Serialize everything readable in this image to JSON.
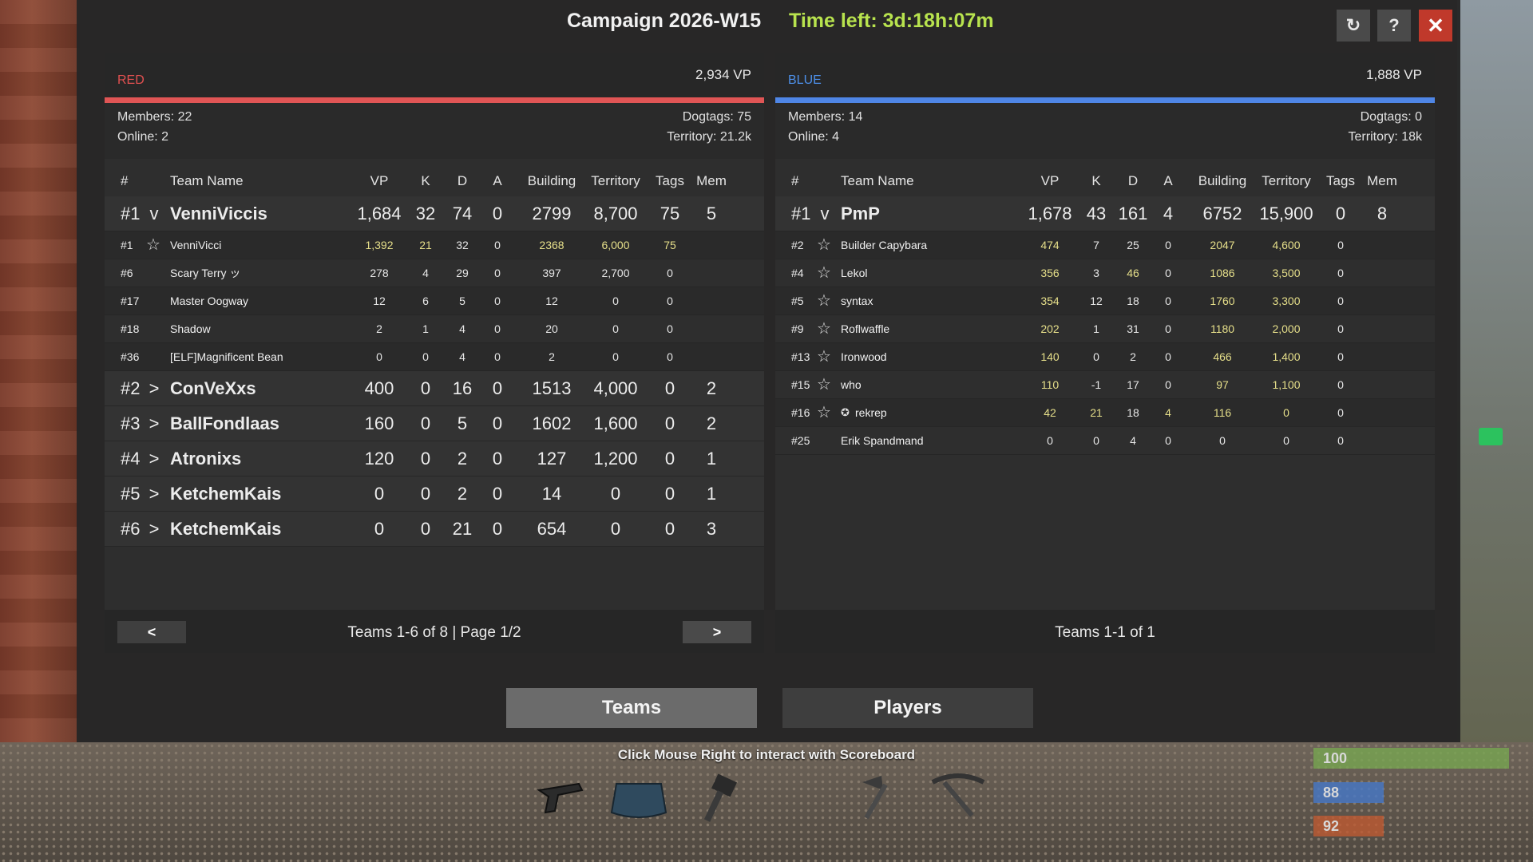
{
  "header": {
    "title": "Campaign 2026-W15",
    "time_left": "Time left: 3d:18h:07m",
    "refresh_icon": "↻",
    "help_icon": "?",
    "close_icon": "✕"
  },
  "columns": [
    "#",
    "Team Name",
    "VP",
    "K",
    "D",
    "A",
    "Building",
    "Territory",
    "Tags",
    "Mem"
  ],
  "red": {
    "name": "RED",
    "vp": "2,934 VP",
    "members": "Members: 22",
    "online": "Online: 2",
    "dogtags": "Dogtags: 75",
    "territory": "Territory: 21.2k",
    "rows": [
      {
        "type": "parent",
        "rank": "#1",
        "toggle": "v",
        "name": "VenniViccis",
        "vp": "1,684",
        "k": "32",
        "d": "74",
        "a": "0",
        "building": "2799",
        "territory": "8,700",
        "tags": "75",
        "mem": "5"
      },
      {
        "type": "child",
        "rank": "#1",
        "star": true,
        "name": "VenniVicci",
        "vp": "1,392",
        "k": "21",
        "d": "32",
        "a": "0",
        "building": "2368",
        "territory": "6,000",
        "tags": "75",
        "mem": ""
      },
      {
        "type": "child",
        "rank": "#6",
        "star": false,
        "name": "Scary Terry ッ",
        "vp": "278",
        "k": "4",
        "d": "29",
        "a": "0",
        "building": "397",
        "territory": "2,700",
        "tags": "0",
        "mem": ""
      },
      {
        "type": "child",
        "rank": "#17",
        "star": false,
        "name": "Master Oogway",
        "vp": "12",
        "k": "6",
        "d": "5",
        "a": "0",
        "building": "12",
        "territory": "0",
        "tags": "0",
        "mem": ""
      },
      {
        "type": "child",
        "rank": "#18",
        "star": false,
        "name": "Shadow",
        "vp": "2",
        "k": "1",
        "d": "4",
        "a": "0",
        "building": "20",
        "territory": "0",
        "tags": "0",
        "mem": ""
      },
      {
        "type": "child",
        "rank": "#36",
        "star": false,
        "name": "[ELF]Magnificent Bean",
        "vp": "0",
        "k": "0",
        "d": "4",
        "a": "0",
        "building": "2",
        "territory": "0",
        "tags": "0",
        "mem": ""
      },
      {
        "type": "parent",
        "rank": "#2",
        "toggle": ">",
        "name": "ConVeXxs",
        "vp": "400",
        "k": "0",
        "d": "16",
        "a": "0",
        "building": "1513",
        "territory": "4,000",
        "tags": "0",
        "mem": "2"
      },
      {
        "type": "parent",
        "rank": "#3",
        "toggle": ">",
        "name": "BallFondlaas",
        "vp": "160",
        "k": "0",
        "d": "5",
        "a": "0",
        "building": "1602",
        "territory": "1,600",
        "tags": "0",
        "mem": "2"
      },
      {
        "type": "parent",
        "rank": "#4",
        "toggle": ">",
        "name": "Atronixs",
        "vp": "120",
        "k": "0",
        "d": "2",
        "a": "0",
        "building": "127",
        "territory": "1,200",
        "tags": "0",
        "mem": "1"
      },
      {
        "type": "parent",
        "rank": "#5",
        "toggle": ">",
        "name": "KetchemKais",
        "vp": "0",
        "k": "0",
        "d": "2",
        "a": "0",
        "building": "14",
        "territory": "0",
        "tags": "0",
        "mem": "1"
      },
      {
        "type": "parent",
        "rank": "#6",
        "toggle": ">",
        "name": "KetchemKais",
        "vp": "0",
        "k": "0",
        "d": "21",
        "a": "0",
        "building": "654",
        "territory": "0",
        "tags": "0",
        "mem": "3"
      }
    ],
    "footer": "Teams 1-6 of 8  |  Page 1/2",
    "prev": "<",
    "next": ">"
  },
  "blue": {
    "name": "BLUE",
    "vp": "1,888 VP",
    "members": "Members: 14",
    "online": "Online: 4",
    "dogtags": "Dogtags: 0",
    "territory": "Territory: 18k",
    "rows": [
      {
        "type": "parent",
        "rank": "#1",
        "toggle": "v",
        "name": "PmP",
        "vp": "1,678",
        "k": "43",
        "d": "161",
        "a": "4",
        "building": "6752",
        "territory": "15,900",
        "tags": "0",
        "mem": "8"
      },
      {
        "type": "child",
        "rank": "#2",
        "star": true,
        "name": "Builder Capybara",
        "vp": "474",
        "k": "7",
        "d": "25",
        "a": "0",
        "building": "2047",
        "territory": "4,600",
        "tags": "0",
        "mem": ""
      },
      {
        "type": "child",
        "rank": "#4",
        "star": true,
        "name": "Lekol",
        "vp": "356",
        "k": "3",
        "d": "46",
        "a": "0",
        "building": "1086",
        "territory": "3,500",
        "tags": "0",
        "mem": ""
      },
      {
        "type": "child",
        "rank": "#5",
        "star": true,
        "name": "syntax",
        "vp": "354",
        "k": "12",
        "d": "18",
        "a": "0",
        "building": "1760",
        "territory": "3,300",
        "tags": "0",
        "mem": ""
      },
      {
        "type": "child",
        "rank": "#9",
        "star": true,
        "name": "Roflwaffle",
        "vp": "202",
        "k": "1",
        "d": "31",
        "a": "0",
        "building": "1180",
        "territory": "2,000",
        "tags": "0",
        "mem": ""
      },
      {
        "type": "child",
        "rank": "#13",
        "star": true,
        "name": "Ironwood",
        "vp": "140",
        "k": "0",
        "d": "2",
        "a": "0",
        "building": "466",
        "territory": "1,400",
        "tags": "0",
        "mem": ""
      },
      {
        "type": "child",
        "rank": "#15",
        "star": true,
        "name": "who",
        "vp": "110",
        "k": "-1",
        "d": "17",
        "a": "0",
        "building": "97",
        "territory": "1,100",
        "tags": "0",
        "mem": ""
      },
      {
        "type": "child",
        "rank": "#16",
        "star": true,
        "badge": true,
        "name": "rekrep",
        "vp": "42",
        "k": "21",
        "d": "18",
        "a": "4",
        "building": "116",
        "territory": "0",
        "tags": "0",
        "mem": ""
      },
      {
        "type": "child",
        "rank": "#25",
        "star": false,
        "name": "Erik Spandmand",
        "vp": "0",
        "k": "0",
        "d": "4",
        "a": "0",
        "building": "0",
        "territory": "0",
        "tags": "0",
        "mem": ""
      }
    ],
    "footer": "Teams 1-1 of 1"
  },
  "tabs": {
    "teams": "Teams",
    "players": "Players"
  },
  "hint": "Click Mouse Right to interact with Scoreboard",
  "hud": {
    "health": "100",
    "water": "88",
    "food": "92"
  },
  "colors": {
    "red": "#e05555",
    "blue": "#4f86e6",
    "accent_yellow": "#e6df8a",
    "time_green": "#b8e34e"
  }
}
